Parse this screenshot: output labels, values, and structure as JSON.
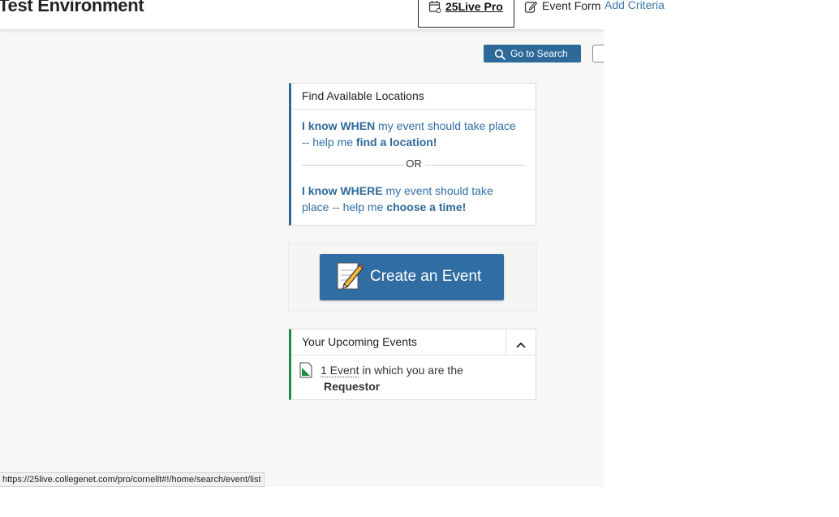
{
  "header": {
    "env_title": "Test Environment",
    "pro_tab_label": "25Live Pro",
    "event_form_label": "Event Form",
    "add_criteria_label": "Add Criteria"
  },
  "toolbar": {
    "go_to_search_label": "Go to Search"
  },
  "find_locations": {
    "title": "Find Available Locations",
    "when_link": {
      "strong1": "I know WHEN",
      "text1": " my event should take place -- help me ",
      "strong2": "find a location!"
    },
    "or_label": "OR",
    "where_link": {
      "strong1": "I know WHERE",
      "text1": " my event should take place -- help me ",
      "strong2": "choose a time!"
    }
  },
  "create_event": {
    "label": "Create an Event"
  },
  "upcoming": {
    "title": "Your Upcoming Events",
    "count_label": "1 Event",
    "text": " in which you are the",
    "role": "Requestor"
  },
  "status_bar": {
    "url": "https://25live.collegenet.com/pro/cornellt#!/home/search/event/list"
  },
  "colors": {
    "primary": "#2d6a9a",
    "link": "#2f6fa6",
    "success_border": "#1e8a4a",
    "background": "#f7f7f5"
  },
  "icons": {
    "pro_tab": "calendar-icon",
    "event_form": "edit-icon",
    "search": "search-icon",
    "create": "notepad-pencil-icon",
    "collapse": "chevron-up-icon",
    "event_doc": "document-icon"
  }
}
